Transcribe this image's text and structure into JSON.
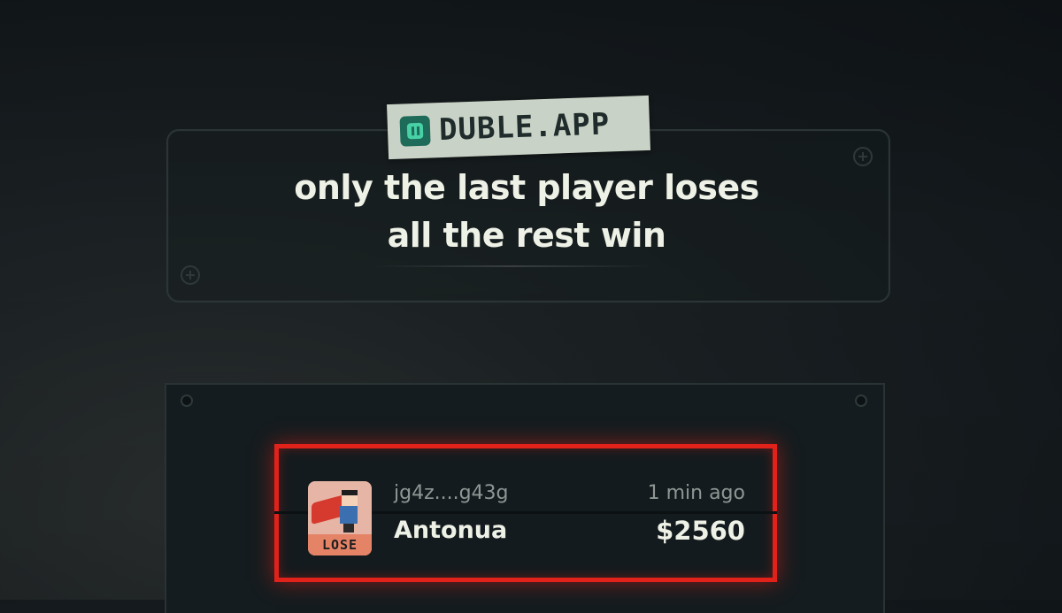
{
  "logo": {
    "text": "DUBLE.APP",
    "icon": "pause-icon"
  },
  "headline": {
    "line1": "only the last player loses",
    "line2": "all the rest win"
  },
  "entry": {
    "status_tag": "LOSE",
    "wallet": "jg4z....g43g",
    "name": "Antonua",
    "time": "1 min ago",
    "amount": "$2560",
    "highlight_color": "#e0221a"
  },
  "colors": {
    "background": "#141a1d",
    "text": "#eef1e6",
    "muted_text": "#8f9694",
    "logo_badge": "#c9d2c6",
    "logo_accent": "#47d1a5",
    "lose_tag": "#e58367"
  }
}
